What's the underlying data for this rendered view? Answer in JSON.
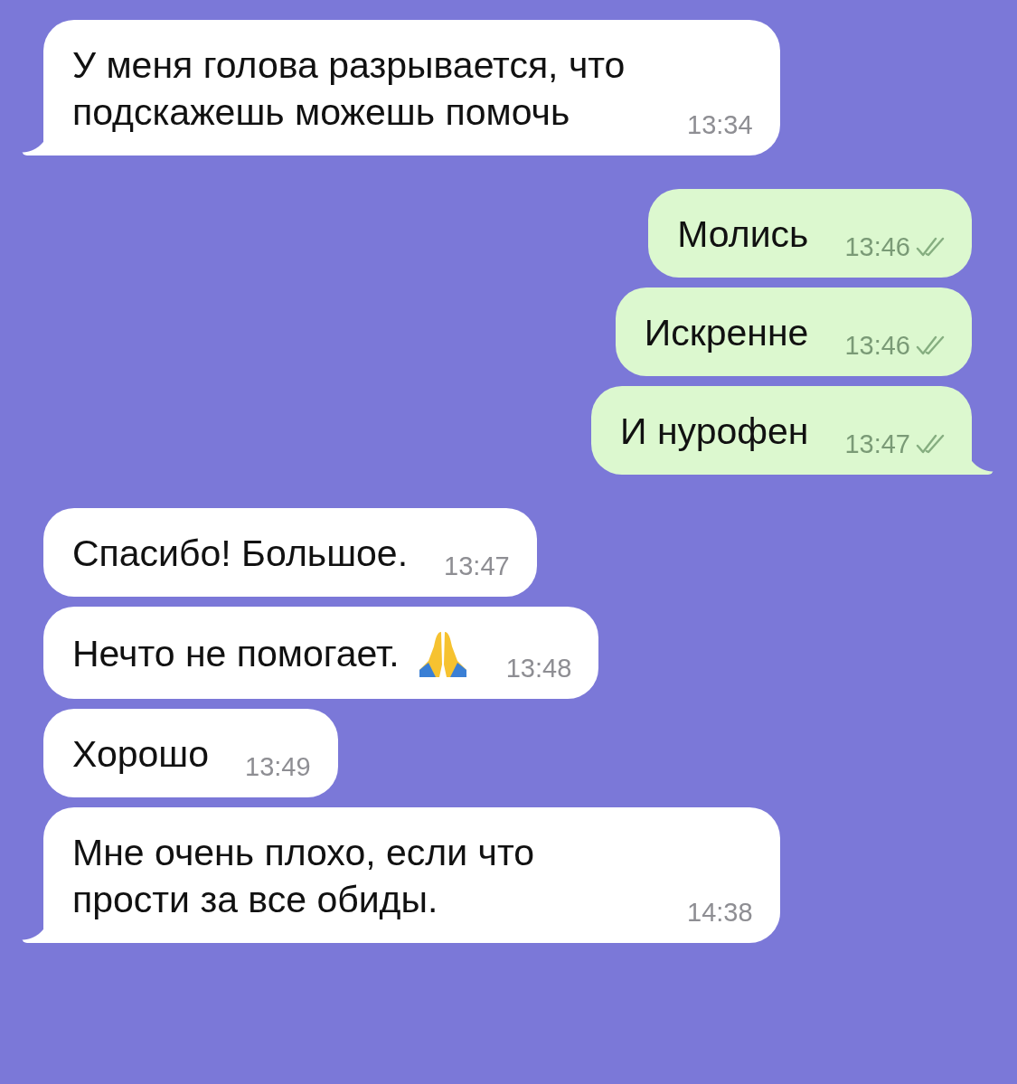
{
  "messages": [
    {
      "kind": "incoming",
      "text": "У меня голова разрывается, что подскажешь можешь помочь",
      "time": "13:34",
      "tail": true
    },
    {
      "kind": "outgoing",
      "text": "Молись",
      "time": "13:46",
      "read": true,
      "tail": false
    },
    {
      "kind": "outgoing",
      "text": "Искренне",
      "time": "13:46",
      "read": true,
      "tail": false
    },
    {
      "kind": "outgoing",
      "text": "И нурофен",
      "time": "13:47",
      "read": true,
      "tail": true
    },
    {
      "kind": "incoming",
      "text": "Спасибо! Большое.",
      "time": "13:47",
      "tail": false
    },
    {
      "kind": "gesture",
      "text": "Нечто не помогает.",
      "time": "13:48",
      "tail": false
    },
    {
      "kind": "incoming",
      "text": "Хорошо",
      "time": "13:49",
      "tail": false
    },
    {
      "kind": "incoming",
      "text": "Мне очень плохо, если что прости за все обиды.",
      "time": "14:38",
      "tail": true
    }
  ]
}
